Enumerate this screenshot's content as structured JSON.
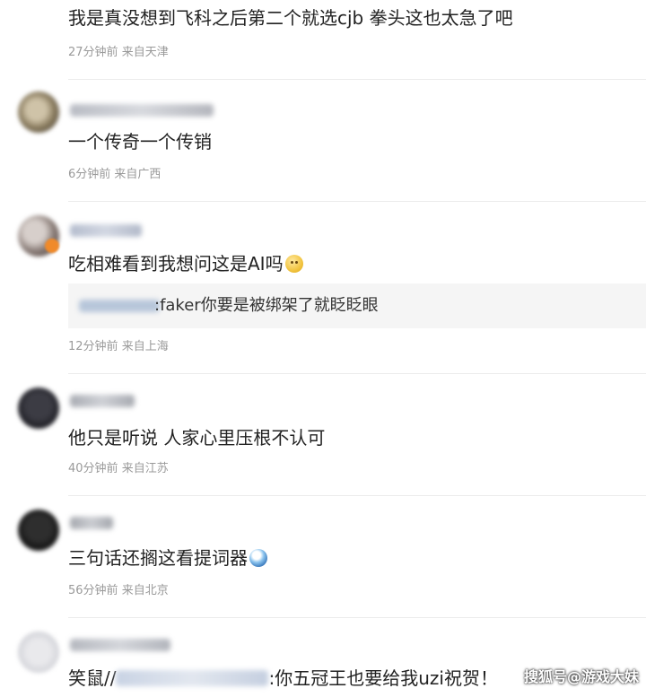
{
  "comments": [
    {
      "text": "我是真没想到飞科之后第二个就选cjb 拳头这也太急了吧",
      "time": "27分钟前",
      "location": "来自天津"
    },
    {
      "text": "一个传奇一个传销",
      "time": "6分钟前",
      "location": "来自广西"
    },
    {
      "text": "吃相难看到我想问这是AI吗",
      "emoji": "smile-emoji",
      "time": "12分钟前",
      "location": "来自上海",
      "reply": {
        "text": ":faker你要是被绑架了就眨眨眼"
      }
    },
    {
      "text": "他只是听说 人家心里压根不认可",
      "time": "40分钟前",
      "location": "来自江苏"
    },
    {
      "text": "三句话还搁这看提词器",
      "emoji": "sweat-face-emoji",
      "time": "56分钟前",
      "location": "来自北京"
    },
    {
      "text_prefix": "笑鼠//",
      "text_suffix": ":你五冠王也要给我uzi祝贺！"
    }
  ],
  "watermark": "搜狐号@游戏大妹"
}
